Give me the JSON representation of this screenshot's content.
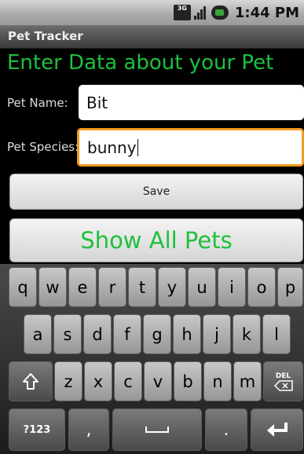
{
  "status_bar": {
    "network": "3G",
    "time": "1:44 PM"
  },
  "app": {
    "title": "Pet Tracker"
  },
  "form": {
    "heading": "Enter Data about your Pet",
    "pet_name_label": "Pet Name:",
    "pet_name_value": "Bit",
    "pet_species_label": "Pet Species:",
    "pet_species_value": "bunny",
    "save_label": "Save",
    "show_all_label": "Show All Pets"
  },
  "colors": {
    "accent": "#1ec03c",
    "focus": "#f39a1e"
  },
  "keyboard": {
    "row1": [
      "q",
      "w",
      "e",
      "r",
      "t",
      "y",
      "u",
      "i",
      "o",
      "p"
    ],
    "row2": [
      "a",
      "s",
      "d",
      "f",
      "g",
      "h",
      "j",
      "k",
      "l"
    ],
    "row3": [
      "z",
      "x",
      "c",
      "v",
      "b",
      "n",
      "m"
    ],
    "shift_icon": "shift-arrow-icon",
    "delete_label": "DEL",
    "numbers_label": "?123",
    "comma_label": ",",
    "period_label": ".",
    "enter_icon": "enter-arrow-icon"
  }
}
